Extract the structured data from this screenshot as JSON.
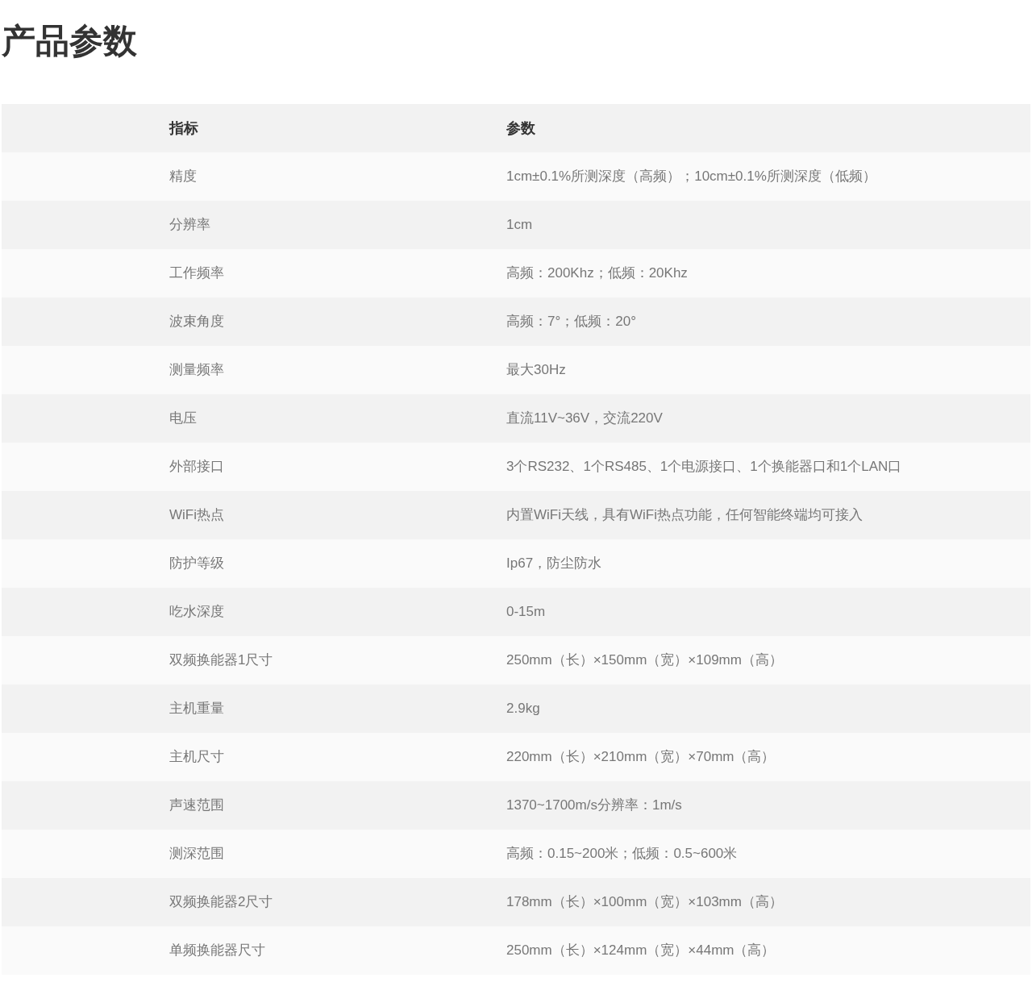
{
  "title": "产品参数",
  "table": {
    "columns": [
      "指标",
      "参数"
    ],
    "rows": [
      [
        "精度",
        "1cm±0.1%所测深度（高频）；10cm±0.1%所测深度（低频）"
      ],
      [
        "分辨率",
        "1cm"
      ],
      [
        "工作频率",
        "高频：200Khz；低频：20Khz"
      ],
      [
        "波束角度",
        "高频：7°；低频：20°"
      ],
      [
        "测量频率",
        "最大30Hz"
      ],
      [
        "电压",
        "直流11V~36V，交流220V"
      ],
      [
        "外部接口",
        "3个RS232、1个RS485、1个电源接口、1个换能器口和1个LAN口"
      ],
      [
        "WiFi热点",
        "内置WiFi天线，具有WiFi热点功能，任何智能终端均可接入"
      ],
      [
        "防护等级",
        "Ip67，防尘防水"
      ],
      [
        "吃水深度",
        "0-15m"
      ],
      [
        "双频换能器1尺寸",
        "250mm（长）×150mm（宽）×109mm（高）"
      ],
      [
        "主机重量",
        "2.9kg"
      ],
      [
        "主机尺寸",
        "220mm（长）×210mm（宽）×70mm（高）"
      ],
      [
        "声速范围",
        "1370~1700m/s分辨率：1m/s"
      ],
      [
        "测深范围",
        "高频：0.15~200米；低频：0.5~600米"
      ],
      [
        "双频换能器2尺寸",
        "178mm（长）×100mm（宽）×103mm（高）"
      ],
      [
        "单频换能器尺寸",
        "250mm（长）×124mm（宽）×44mm（高）"
      ]
    ]
  }
}
